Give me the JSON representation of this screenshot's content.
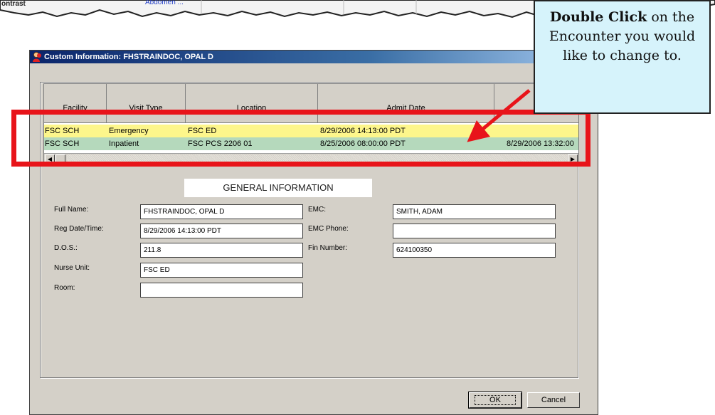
{
  "background": {
    "label": "ontrast",
    "link": "Abdomen ..."
  },
  "dialog": {
    "title": "Custom Information: FHSTRAINDOC, OPAL D"
  },
  "grid": {
    "columns": [
      "Facility",
      "Visit Type",
      "Location",
      "Admit Date",
      ""
    ],
    "rows": [
      {
        "facility": "FSC SCH",
        "visit_type": "Emergency",
        "location": "FSC ED",
        "admit_date": "8/29/2006 14:13:00 PDT",
        "extra": ""
      },
      {
        "facility": "FSC SCH",
        "visit_type": "Inpatient",
        "location": "FSC PCS 2206 01",
        "admit_date": "8/25/2006 08:00:00 PDT",
        "extra": "8/29/2006 13:32:00"
      }
    ]
  },
  "general_info": {
    "header": "GENERAL INFORMATION",
    "full_name_label": "Full Name:",
    "full_name": "FHSTRAINDOC, OPAL D",
    "reg_date_label": "Reg Date/Time:",
    "reg_date": "8/29/2006 14:13:00 PDT",
    "dos_label": "D.O.S.:",
    "dos": "211.8",
    "nurse_unit_label": "Nurse Unit:",
    "nurse_unit": "FSC ED",
    "room_label": "Room:",
    "room": "",
    "emc_label": "EMC:",
    "emc": "SMITH, ADAM",
    "emc_phone_label": "EMC Phone:",
    "emc_phone": "",
    "fin_label": "Fin Number:",
    "fin": "624100350"
  },
  "buttons": {
    "ok": "OK",
    "cancel": "Cancel"
  },
  "callout": {
    "bold": "Double Click",
    "text": " on the Encounter you would like to change to."
  },
  "colors": {
    "highlight": "#e8141a",
    "row_selected": "#fdf68b",
    "row_alt": "#b5d9bc",
    "callout_bg": "#d6f3fb"
  }
}
